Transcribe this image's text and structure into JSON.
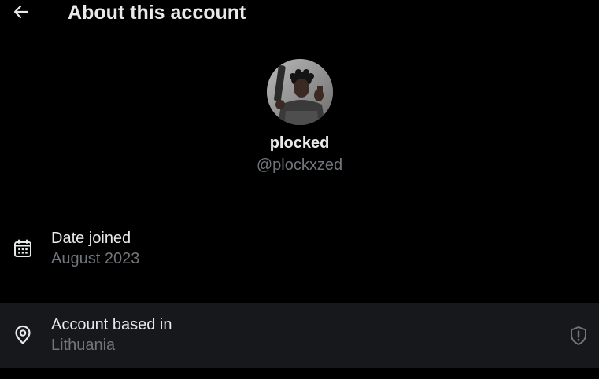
{
  "header": {
    "back_icon": "arrow-left-icon",
    "title": "About this account"
  },
  "profile": {
    "display_name": "plocked",
    "handle": "@plockxzed"
  },
  "info": {
    "date_joined": {
      "icon": "calendar-icon",
      "label": "Date joined",
      "value": "August 2023"
    },
    "account_based_in": {
      "icon": "location-pin-icon",
      "label": "Account based in",
      "value": "Lithuania",
      "trailing_icon": "shield-alert-icon"
    }
  },
  "colors": {
    "background": "#000000",
    "primary_text": "#e7e9ea",
    "secondary_text": "#71767b",
    "highlight_row": "#16181c"
  }
}
